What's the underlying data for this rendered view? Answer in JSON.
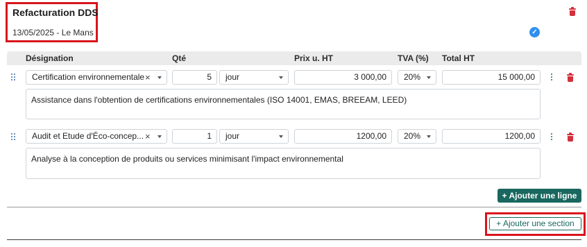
{
  "section": {
    "title": "Refacturation DDS",
    "subtitle": "13/05/2025 - Le Mans",
    "status_icon": "check-circle-icon",
    "accent_color": "#2f8ff0",
    "delete_color": "#d32f3c"
  },
  "table": {
    "headers": {
      "designation": "Désignation",
      "qty": "Qté",
      "unit_price": "Prix u. HT",
      "vat": "TVA (%)",
      "total": "Total HT"
    },
    "rows": [
      {
        "designation": "Certification environnementale",
        "qty": "5",
        "unit": "jour",
        "unit_price": "3 000,00",
        "vat": "20%",
        "total": "15 000,00",
        "description": "Assistance dans l'obtention de certifications environnementales (ISO 14001, EMAS, BREEAM, LEED)"
      },
      {
        "designation": "Audit et Etude d'Éco-concep...",
        "qty": "1",
        "unit": "jour",
        "unit_price": "1200,00",
        "vat": "20%",
        "total": "1200,00",
        "description": "Analyse à la conception de produits ou services minimisant l'impact environnemental"
      }
    ]
  },
  "actions": {
    "add_line": "+ Ajouter une ligne",
    "add_section": "+ Ajouter une section",
    "primary_color": "#19675f"
  },
  "icons": {
    "clear": "×",
    "check": "✓"
  }
}
